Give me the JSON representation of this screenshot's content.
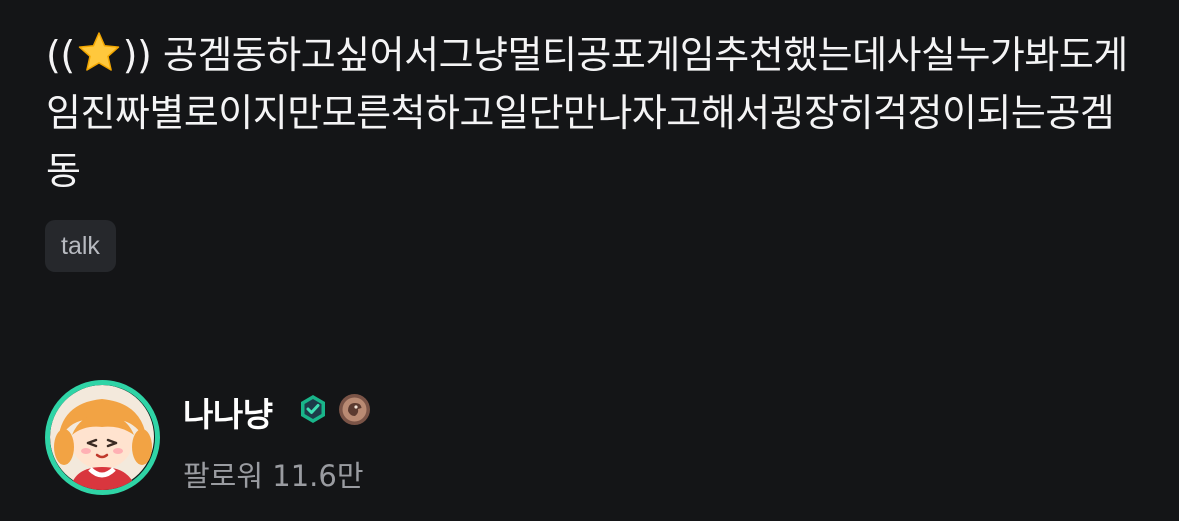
{
  "post": {
    "title_prefix": "((",
    "title_suffix": ")) 공겜동하고싶어서그냥멀티공포게임추천했는데사실누가봐도게임진짜별로이지만모른척하고일단만나자고해서굉장히걱정이되는공겜동",
    "title_icon": "star-icon",
    "tag": "talk"
  },
  "author": {
    "name": "나나냥",
    "partner_badge_icon": "partner-check-icon",
    "level_badge_icon": "level-badge-icon",
    "followers_label": "팔로워",
    "followers_count": "11.6만"
  },
  "colors": {
    "background": "#141517",
    "avatar_ring": "#2fd4a6",
    "partner_badge": "#19b58a",
    "tag_bg": "#26282c",
    "muted_text": "#9a9ca1"
  }
}
